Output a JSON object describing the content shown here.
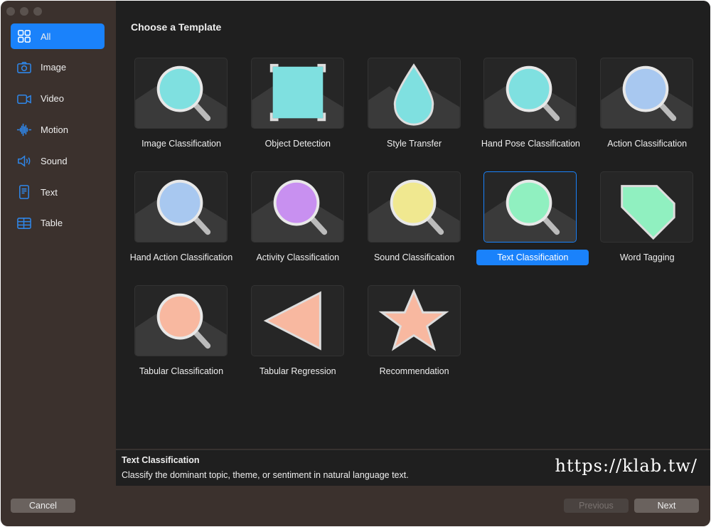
{
  "sidebar": {
    "items": [
      {
        "label": "All",
        "icon": "grid-icon",
        "selected": true
      },
      {
        "label": "Image",
        "icon": "camera-icon"
      },
      {
        "label": "Video",
        "icon": "video-icon"
      },
      {
        "label": "Motion",
        "icon": "waveform-icon"
      },
      {
        "label": "Sound",
        "icon": "speaker-icon"
      },
      {
        "label": "Text",
        "icon": "document-icon"
      },
      {
        "label": "Table",
        "icon": "table-icon"
      }
    ]
  },
  "main": {
    "title": "Choose a Template",
    "templates": [
      {
        "label": "Image Classification",
        "icon": "image-magnifier-icon",
        "color": "#7fe0e0",
        "shape": "mag"
      },
      {
        "label": "Object Detection",
        "icon": "object-detection-icon",
        "color": "#7fe0e0",
        "shape": "square"
      },
      {
        "label": "Style Transfer",
        "icon": "drop-icon",
        "color": "#7fe0e0",
        "shape": "drop"
      },
      {
        "label": "Hand Pose Classification",
        "icon": "hand-pose-magnifier-icon",
        "color": "#7fe0e0",
        "shape": "mag"
      },
      {
        "label": "Action Classification",
        "icon": "action-magnifier-icon",
        "color": "#a8c8f0",
        "shape": "mag"
      },
      {
        "label": "Hand Action Classification",
        "icon": "hand-action-magnifier-icon",
        "color": "#a8c8f0",
        "shape": "mag"
      },
      {
        "label": "Activity Classification",
        "icon": "activity-magnifier-icon",
        "color": "#c890f0",
        "shape": "mag"
      },
      {
        "label": "Sound Classification",
        "icon": "sound-magnifier-icon",
        "color": "#f0e890",
        "shape": "mag"
      },
      {
        "label": "Text Classification",
        "icon": "text-magnifier-icon",
        "color": "#90f0c0",
        "shape": "mag",
        "selected": true
      },
      {
        "label": "Word Tagging",
        "icon": "tag-icon",
        "color": "#90f0c0",
        "shape": "tag"
      },
      {
        "label": "Tabular Classification",
        "icon": "table-magnifier-icon",
        "color": "#f8b8a0",
        "shape": "mag"
      },
      {
        "label": "Tabular Regression",
        "icon": "triangle-icon",
        "color": "#f8b8a0",
        "shape": "tri"
      },
      {
        "label": "Recommendation",
        "icon": "star-icon",
        "color": "#f8b8a0",
        "shape": "star"
      }
    ]
  },
  "detail": {
    "title": "Text Classification",
    "description": "Classify the dominant topic, theme, or sentiment in natural language text."
  },
  "watermark": "https://klab.tw/",
  "footer": {
    "cancel": "Cancel",
    "previous": "Previous",
    "next": "Next"
  },
  "colors": {
    "accent": "#1a82fb"
  }
}
